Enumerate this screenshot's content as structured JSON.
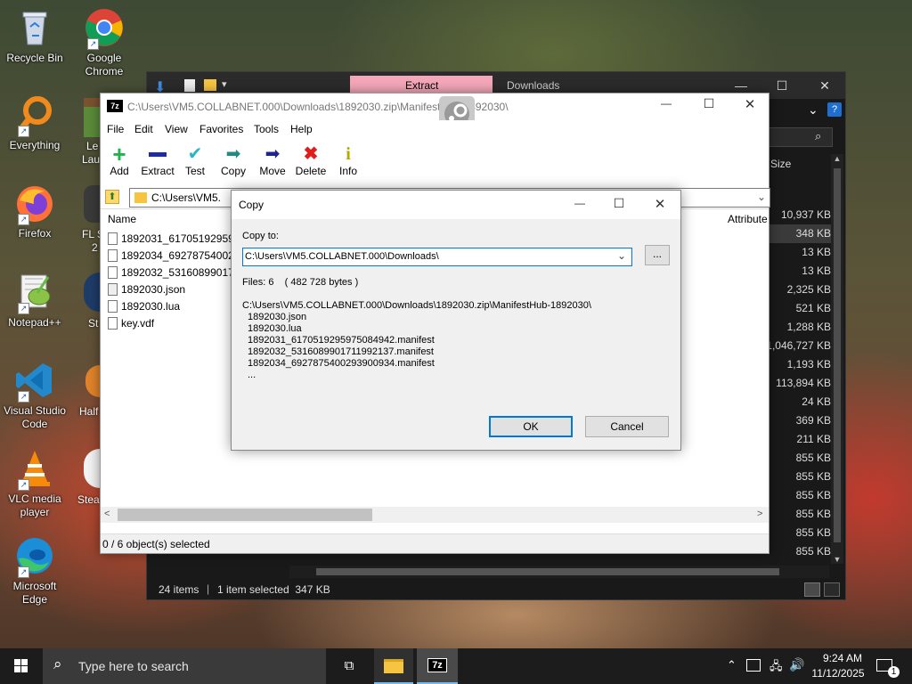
{
  "desktop": {
    "icons": [
      {
        "label": "Recycle Bin",
        "icon": "recycle-bin-icon"
      },
      {
        "label": "Google Chrome",
        "icon": "chrome-icon"
      },
      {
        "label": "Everything",
        "icon": "everything-icon"
      },
      {
        "label": "Firefox",
        "icon": "firefox-icon"
      },
      {
        "label": "Notepad++",
        "icon": "notepadpp-icon"
      },
      {
        "label": "Visual Studio Code",
        "icon": "vscode-icon"
      },
      {
        "label": "VLC media player",
        "icon": "vlc-icon"
      },
      {
        "label": "Microsoft Edge",
        "icon": "edge-icon"
      }
    ],
    "partial_labels": [
      "Le",
      "Lau",
      "FL S",
      "2",
      "St",
      "Half",
      "Stea"
    ]
  },
  "explorer": {
    "tab_extract": "Extract",
    "tab_downloads": "Downloads",
    "column_size": "Size",
    "column_attributes": "Attribute",
    "sizes": [
      "10,937 KB",
      "348 KB",
      "13 KB",
      "13 KB",
      "2,325 KB",
      "521 KB",
      "1,288 KB",
      "1,046,727 KB",
      "1,193 KB",
      "113,894 KB",
      "24 KB",
      "369 KB",
      "211 KB",
      "855 KB",
      "855 KB",
      "855 KB",
      "855 KB",
      "855 KB",
      "855 KB"
    ],
    "status_items": "24 items",
    "status_selected": "1 item selected  347 KB"
  },
  "zip": {
    "title": "C:\\Users\\VM5.COLLABNET.000\\Downloads\\1892030.zip\\ManifestHub-1892030\\",
    "menu": [
      "File",
      "Edit",
      "View",
      "Favorites",
      "Tools",
      "Help"
    ],
    "toolbar": [
      "Add",
      "Extract",
      "Test",
      "Copy",
      "Move",
      "Delete",
      "Info"
    ],
    "address": "C:\\Users\\VM5.",
    "column_name": "Name",
    "files": [
      "1892031_6170519295975",
      "1892034_6927875400293",
      "1892032_5316089901711",
      "1892030.json",
      "1892030.lua",
      "key.vdf"
    ],
    "status": "0 / 6 object(s) selected"
  },
  "dialog": {
    "title": "Copy",
    "copy_to_label": "Copy to:",
    "path": "C:\\Users\\VM5.COLLABNET.000\\Downloads\\",
    "browse": "...",
    "files_info": "Files: 6    ( 482 728 bytes )",
    "source": "C:\\Users\\VM5.COLLABNET.000\\Downloads\\1892030.zip\\ManifestHub-1892030\\",
    "items": [
      "1892030.json",
      "1892030.lua",
      "1892031_6170519295975084942.manifest",
      "1892032_5316089901711992137.manifest",
      "1892034_6927875400293900934.manifest",
      "..."
    ],
    "ok": "OK",
    "cancel": "Cancel"
  },
  "taskbar": {
    "search_placeholder": "Type here to search",
    "time": "9:24 AM",
    "date": "11/12/2025",
    "notification_count": "1"
  }
}
